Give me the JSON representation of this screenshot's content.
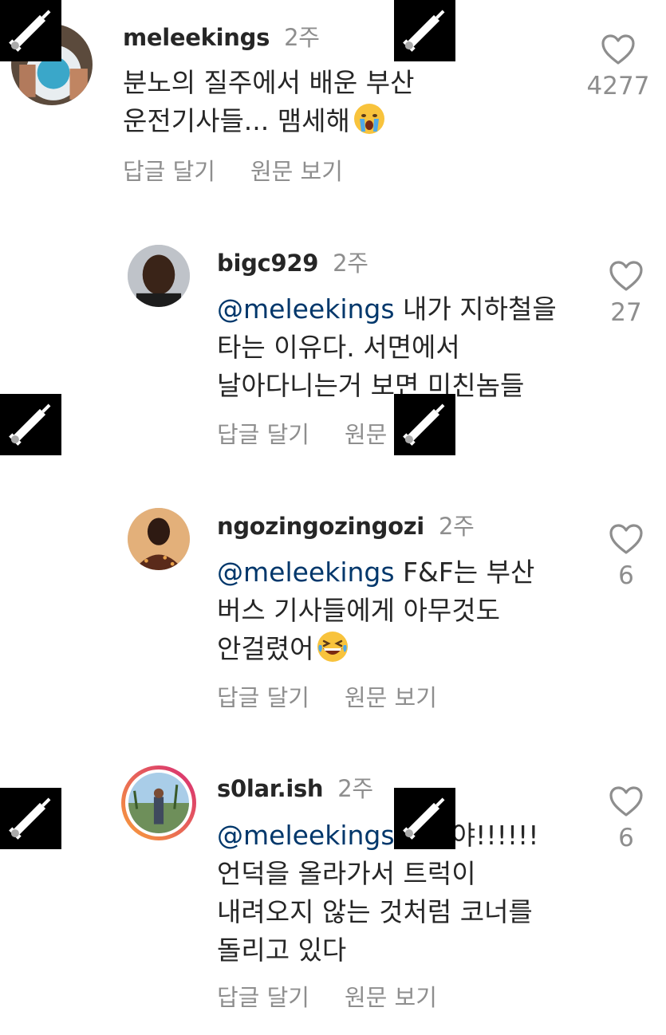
{
  "actions": {
    "reply": "답글 달기",
    "see_translation": "원문 보기"
  },
  "comments": [
    {
      "username": "meleekings",
      "time": "2주",
      "lines": [
        "분노의 질주에서 배운 부산",
        "운전기사들... 맴세해"
      ],
      "emoji": "crying-face",
      "likes": "4277"
    },
    {
      "username": "bigc929",
      "time": "2주",
      "mention": "@meleekings",
      "lines": [
        " 내가 지하철을",
        "타는 이유다. 서면에서",
        "날아다니는거 보면 미친놈들"
      ],
      "likes": "27"
    },
    {
      "username": "ngozingozingozi",
      "time": "2주",
      "mention": "@meleekings",
      "lines": [
        " F&F는 부산",
        "버스 기사들에게 아무것도",
        "안걸렸어"
      ],
      "emoji": "grinning-squinting-face",
      "likes": "6"
    },
    {
      "username": "s0lar.ish",
      "time": "2주",
      "mention": "@meleekings",
      "lines": [
        " 실이야!!!!!!",
        "언덕을 올라가서 트럭이",
        "내려오지 않는 것처럼 코너를",
        "돌리고 있다"
      ],
      "likes": "6"
    }
  ],
  "colors": {
    "text": "#262626",
    "secondary": "#8e8e8e",
    "mention": "#00376b",
    "story_ring_start": "#f9a13a",
    "story_ring_end": "#d62976"
  }
}
